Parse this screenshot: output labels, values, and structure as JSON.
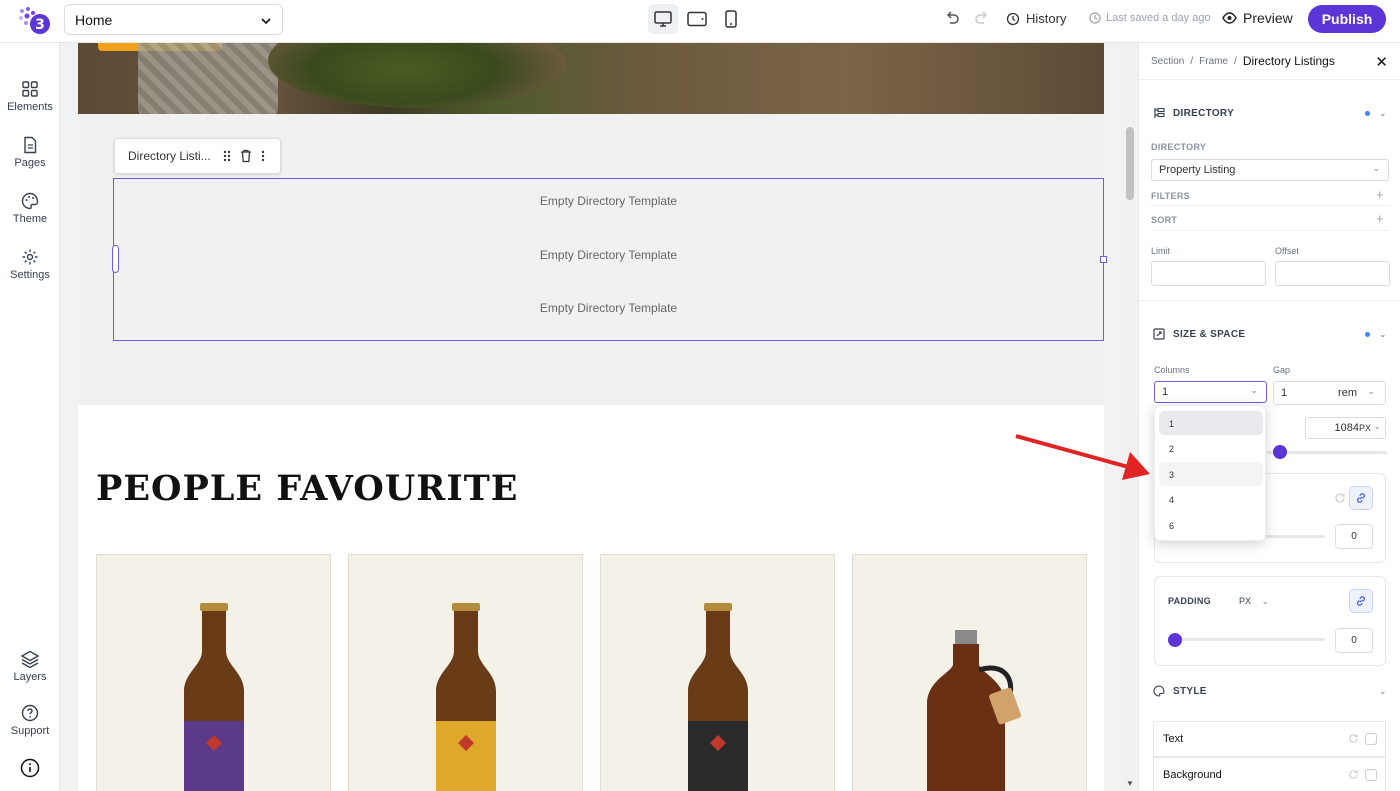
{
  "topbar": {
    "page_name": "Home",
    "history_label": "History",
    "saved_label": "Last saved a day ago",
    "preview_label": "Preview",
    "publish_label": "Publish"
  },
  "rail": {
    "elements": "Elements",
    "pages": "Pages",
    "theme": "Theme",
    "settings": "Settings",
    "layers": "Layers",
    "support": "Support"
  },
  "canvas": {
    "chip_label": "Directory Listi...",
    "empty_rows": [
      "Empty Directory Template",
      "Empty Directory Template",
      "Empty Directory Template"
    ],
    "heading": "PEOPLE FAVOURITE"
  },
  "panel": {
    "breadcrumb": [
      "Section",
      "Frame"
    ],
    "breadcrumb_current": "Directory Listings",
    "directory_title": "DIRECTORY",
    "directory_label": "DIRECTORY",
    "directory_value": "Property Listing",
    "filters_label": "FILTERS",
    "sort_label": "SORT",
    "limit_label": "Limit",
    "offset_label": "Offset",
    "size_title": "SIZE & SPACE",
    "columns_label": "Columns",
    "columns_value": "1",
    "gap_label": "Gap",
    "gap_value": "1",
    "gap_unit": "rem",
    "width_value": "1084",
    "width_unit": "PX",
    "margin_value": "0",
    "padding_label": "PADDING",
    "padding_unit": "PX",
    "padding_value": "0",
    "style_title": "STYLE",
    "text_label": "Text",
    "background_label": "Background"
  },
  "columns_dropdown": {
    "options": [
      "1",
      "2",
      "3",
      "4",
      "6"
    ],
    "selected": "1",
    "hovered": "3"
  },
  "colors": {
    "accent": "#5b35d5",
    "selection": "#6d5ce0",
    "arrow": "#e02424"
  }
}
